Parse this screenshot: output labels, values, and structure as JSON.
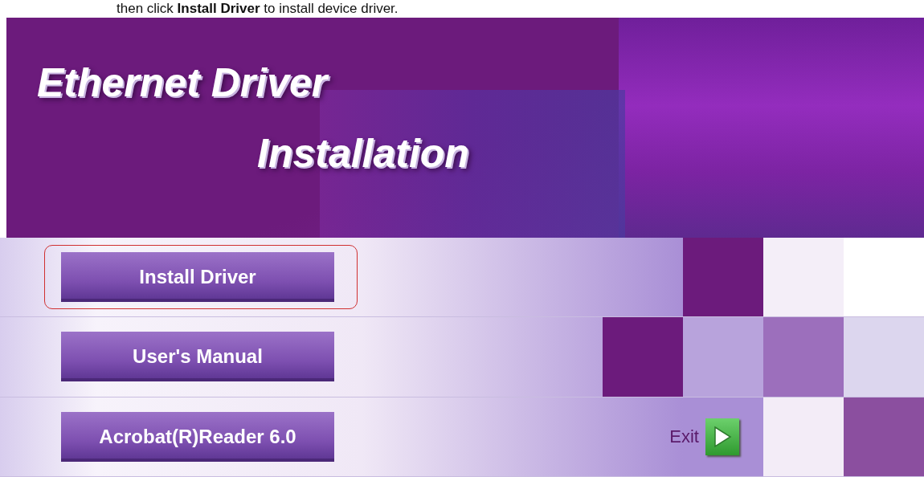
{
  "caption": "then click **Install Driver** to install device driver.",
  "banner": {
    "title_line_1": "Ethernet Driver",
    "title_line_2": "Installation"
  },
  "buttons": [
    {
      "label": "Install Driver",
      "highlighted": true
    },
    {
      "label": "User's Manual",
      "highlighted": false
    },
    {
      "label": "Acrobat(R)Reader 6.0",
      "highlighted": false
    }
  ],
  "exit": {
    "label": "Exit"
  }
}
